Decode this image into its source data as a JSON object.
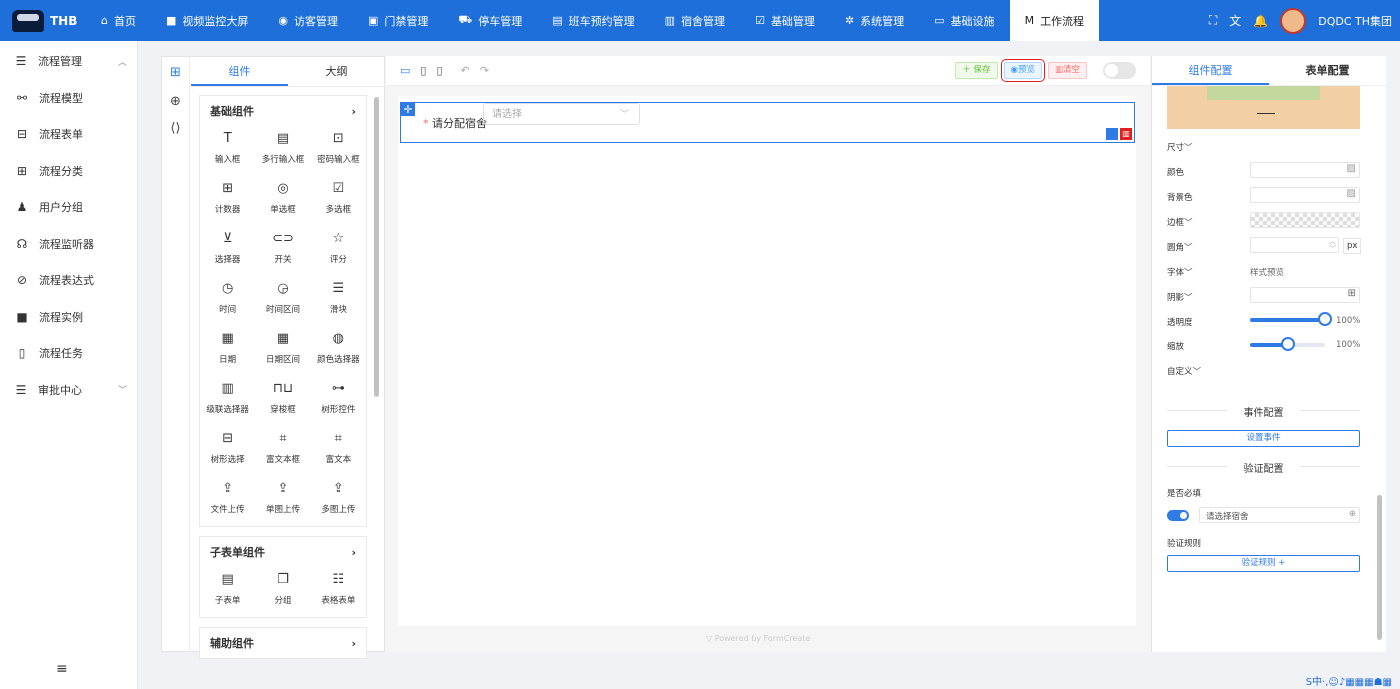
{
  "brand": "THB",
  "nav": [
    {
      "icon": "⌂",
      "label": "首页"
    },
    {
      "icon": "■",
      "label": "视频监控大屏"
    },
    {
      "icon": "◉",
      "label": "访客管理"
    },
    {
      "icon": "▣",
      "label": "门禁管理"
    },
    {
      "icon": "⛟",
      "label": "停车管理"
    },
    {
      "icon": "▤",
      "label": "班车预约管理"
    },
    {
      "icon": "▥",
      "label": "宿舍管理"
    },
    {
      "icon": "☑",
      "label": "基础管理"
    },
    {
      "icon": "✲",
      "label": "系统管理"
    },
    {
      "icon": "▭",
      "label": "基础设施"
    },
    {
      "icon": "M",
      "label": "工作流程"
    }
  ],
  "user": {
    "name": "DQDC TH集团"
  },
  "top_icons": [
    "⛶",
    "文",
    "🔔"
  ],
  "sidebar": {
    "group1": {
      "icon": "☰",
      "label": "流程管理"
    },
    "items": [
      {
        "icon": "⚯",
        "label": "流程模型"
      },
      {
        "icon": "⊟",
        "label": "流程表单"
      },
      {
        "icon": "⊞",
        "label": "流程分类"
      },
      {
        "icon": "♟",
        "label": "用户分组"
      },
      {
        "icon": "☊",
        "label": "流程监听器"
      },
      {
        "icon": "⊘",
        "label": "流程表达式"
      },
      {
        "icon": "■",
        "label": "流程实例"
      },
      {
        "icon": "▯",
        "label": "流程任务"
      }
    ],
    "group2": {
      "icon": "☰",
      "label": "审批中心"
    },
    "collapse_icon": "≡"
  },
  "left_panel": {
    "tabs": [
      "组件",
      "大纲"
    ],
    "groups": [
      {
        "title": "基础组件",
        "items": [
          {
            "icon": "T",
            "label": "输入框"
          },
          {
            "icon": "▤",
            "label": "多行输入框"
          },
          {
            "icon": "⊡",
            "label": "密码输入框"
          },
          {
            "icon": "⊞",
            "label": "计数器"
          },
          {
            "icon": "◎",
            "label": "单选框"
          },
          {
            "icon": "☑",
            "label": "多选框"
          },
          {
            "icon": "⊻",
            "label": "选择器"
          },
          {
            "icon": "⊂⊃",
            "label": "开关"
          },
          {
            "icon": "☆",
            "label": "评分"
          },
          {
            "icon": "◷",
            "label": "时间"
          },
          {
            "icon": "◶",
            "label": "时间区间"
          },
          {
            "icon": "☰",
            "label": "滑块"
          },
          {
            "icon": "▦",
            "label": "日期"
          },
          {
            "icon": "▦",
            "label": "日期区间"
          },
          {
            "icon": "◍",
            "label": "颜色选择器"
          },
          {
            "icon": "▥",
            "label": "级联选择器"
          },
          {
            "icon": "⊓⊔",
            "label": "穿梭框"
          },
          {
            "icon": "⊶",
            "label": "树形控件"
          },
          {
            "icon": "⊟",
            "label": "树形选择"
          },
          {
            "icon": "⌗",
            "label": "富文本框"
          },
          {
            "icon": "⌗",
            "label": "富文本"
          },
          {
            "icon": "⇪",
            "label": "文件上传"
          },
          {
            "icon": "⇪",
            "label": "单图上传"
          },
          {
            "icon": "⇪",
            "label": "多图上传"
          }
        ]
      },
      {
        "title": "子表单组件",
        "items": [
          {
            "icon": "▤",
            "label": "子表单"
          },
          {
            "icon": "❐",
            "label": "分组"
          },
          {
            "icon": "☷",
            "label": "表格表单"
          }
        ]
      },
      {
        "title": "辅助组件",
        "items": []
      }
    ]
  },
  "toolbar": {
    "save": "保存",
    "preview": "预览",
    "clear": "清空"
  },
  "form_field": {
    "label": "请分配宿舍",
    "placeholder": "请选择"
  },
  "powered_by": "Powered by FormCreate",
  "right_panel": {
    "tabs": [
      "组件配置",
      "表单配置"
    ],
    "rows": {
      "size": "尺寸",
      "color": "颜色",
      "bg": "背景色",
      "border": "边框",
      "radius": "圆角",
      "font": "字体",
      "font_preview": "样式预览",
      "shadow": "阴影",
      "opacity": "透明度",
      "scale": "缩放",
      "custom": "自定义",
      "px": "px"
    },
    "opacity_value": "100%",
    "scale_value": "100%",
    "opacity_level": 1.0,
    "scale_level": 0.5,
    "event_title": "事件配置",
    "event_btn": "设置事件",
    "validate_title": "验证配置",
    "required_label": "是否必填",
    "required_placeholder": "请选择宿舍",
    "rules_label": "验证规则",
    "rules_btn": "验证规则 +"
  },
  "tray": "S中·,☺♪▦▦▦☗▦"
}
